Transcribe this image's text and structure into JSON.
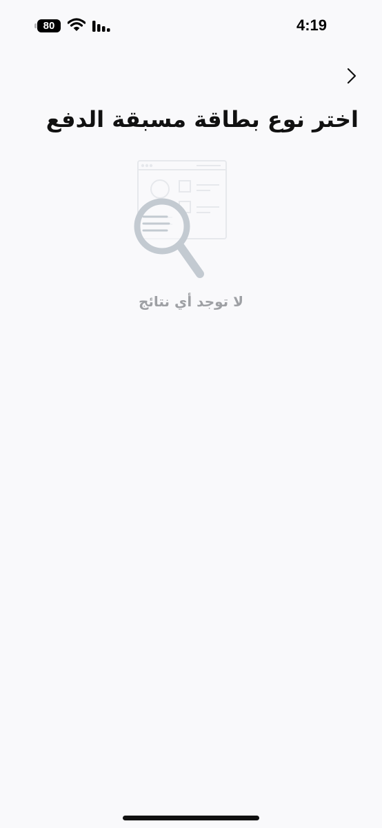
{
  "status_bar": {
    "battery_level": "80",
    "time": "4:19"
  },
  "header": {
    "title": "اختر نوع بطاقة مسبقة الدفع",
    "back_icon": "chevron-right-icon"
  },
  "empty_state": {
    "icon": "magnifier-document-icon",
    "message": "لا توجد أي نتائج"
  },
  "colors": {
    "background": "#f9f9fb",
    "title": "#111111",
    "muted_text": "#9ea0a4",
    "illustration": "#c3cad1"
  }
}
